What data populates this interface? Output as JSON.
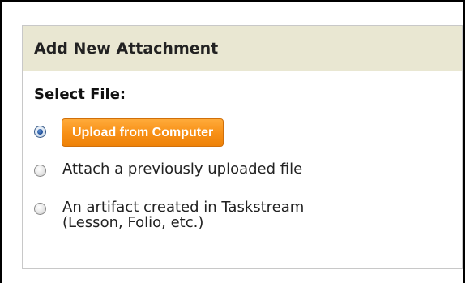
{
  "panel": {
    "title": "Add New Attachment",
    "section_label": "Select File:"
  },
  "options": [
    {
      "label": "Upload from Computer",
      "checked": true
    },
    {
      "label": "Attach a previously uploaded file",
      "checked": false
    },
    {
      "label_line1": "An artifact created in Taskstream",
      "label_line2": "(Lesson, Folio, etc.)",
      "checked": false
    }
  ],
  "colors": {
    "header_bg": "#e9e7d2",
    "button_orange": "#f78f15"
  }
}
